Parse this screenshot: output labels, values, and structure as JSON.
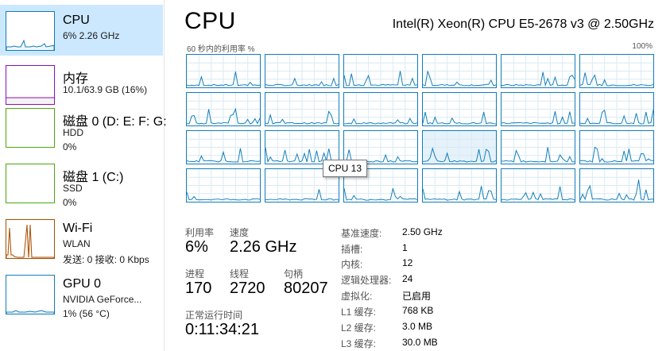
{
  "sidebar": {
    "items": [
      {
        "title": "CPU",
        "line2": "6% 2.26 GHz",
        "line3": "",
        "color": "#117dbb",
        "fill": "#f1f6fa"
      },
      {
        "title": "内存",
        "line2": "10.1/63.9 GB (16%)",
        "line3": "",
        "color": "#8b12ae",
        "fill": "#f4f2f4"
      },
      {
        "title": "磁盘 0 (D: E: F: G:",
        "line2": "HDD",
        "line3": "0%",
        "color": "#4da60c",
        "fill": "#eff7ea"
      },
      {
        "title": "磁盘 1 (C:)",
        "line2": "SSD",
        "line3": "0%",
        "color": "#4da60c",
        "fill": "#eff7ea"
      },
      {
        "title": "Wi-Fi",
        "line2": "WLAN",
        "line3": "发送: 0 接收: 0 Kbps",
        "color": "#a74f01",
        "fill": "#fcf3eb"
      },
      {
        "title": "GPU 0",
        "line2": "NVIDIA GeForce...",
        "line3": "1% (56 °C)",
        "color": "#117dbb",
        "fill": "#f1f6fa"
      }
    ]
  },
  "header": {
    "title": "CPU",
    "model": "Intel(R) Xeon(R) CPU E5-2678 v3 @ 2.50GHz"
  },
  "graph": {
    "caption": "60 秒内的利用率 %",
    "max_label": "100%",
    "tooltip": "CPU 13",
    "line_color": "#117dbb",
    "grid_color": "#d9eaf4"
  },
  "stats": {
    "utilization_label": "利用率",
    "utilization": "6%",
    "speed_label": "速度",
    "speed": "2.26 GHz",
    "processes_label": "进程",
    "processes": "170",
    "threads_label": "线程",
    "threads": "2720",
    "handles_label": "句柄",
    "handles": "80207",
    "uptime_label": "正常运行时间",
    "uptime": "0:11:34:21"
  },
  "info": [
    {
      "label": "基准速度:",
      "value": "2.50 GHz"
    },
    {
      "label": "插槽:",
      "value": "1"
    },
    {
      "label": "内核:",
      "value": "12"
    },
    {
      "label": "逻辑处理器:",
      "value": "24"
    },
    {
      "label": "虚拟化:",
      "value": "已启用"
    },
    {
      "label": "L1 缓存:",
      "value": "768 KB"
    },
    {
      "label": "L2 缓存:",
      "value": "3.0 MB"
    },
    {
      "label": "L3 缓存:",
      "value": "30.0 MB"
    }
  ]
}
